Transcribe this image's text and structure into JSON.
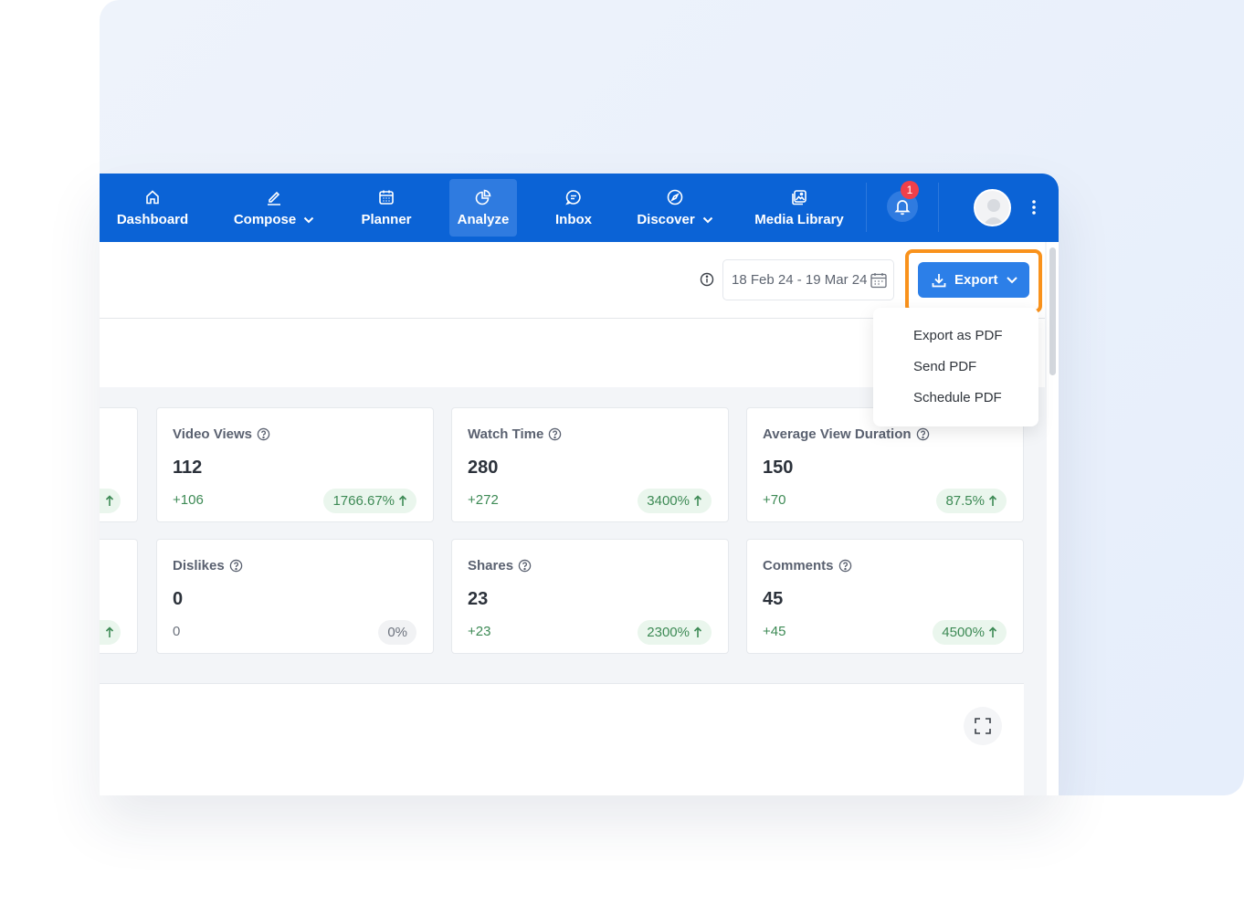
{
  "nav": {
    "items": [
      {
        "label": "Dashboard",
        "icon": "home-icon"
      },
      {
        "label": "Compose",
        "icon": "pencil-icon",
        "dropdown": true
      },
      {
        "label": "Planner",
        "icon": "calendar-icon"
      },
      {
        "label": "Analyze",
        "icon": "pie-chart-icon",
        "active": true
      },
      {
        "label": "Inbox",
        "icon": "chat-icon"
      },
      {
        "label": "Discover",
        "icon": "compass-icon",
        "dropdown": true
      },
      {
        "label": "Media Library",
        "icon": "images-icon"
      }
    ],
    "notification_count": "1"
  },
  "header": {
    "date_range": "18 Feb 24 - 19 Mar 24",
    "export_label": "Export"
  },
  "export_menu": {
    "options": [
      "Export as PDF",
      "Send PDF",
      "Schedule PDF"
    ]
  },
  "metrics": [
    {
      "title": "Video Views",
      "value": "112",
      "delta": "+106",
      "pct": "1766.67%"
    },
    {
      "title": "Watch Time",
      "value": "280",
      "delta": "+272",
      "pct": "3400%"
    },
    {
      "title": "Average View Duration",
      "value": "150",
      "delta": "+70",
      "pct": "87.5%"
    },
    {
      "title": "Dislikes",
      "value": "0",
      "delta": "0",
      "pct": "0%"
    },
    {
      "title": "Shares",
      "value": "23",
      "delta": "+23",
      "pct": "2300%"
    },
    {
      "title": "Comments",
      "value": "45",
      "delta": "+45",
      "pct": "4500%"
    }
  ],
  "colors": {
    "nav_bg": "#0b63d6",
    "accent": "#2c7fe8",
    "highlight": "#f9921c",
    "positive": "#3d8a55"
  }
}
